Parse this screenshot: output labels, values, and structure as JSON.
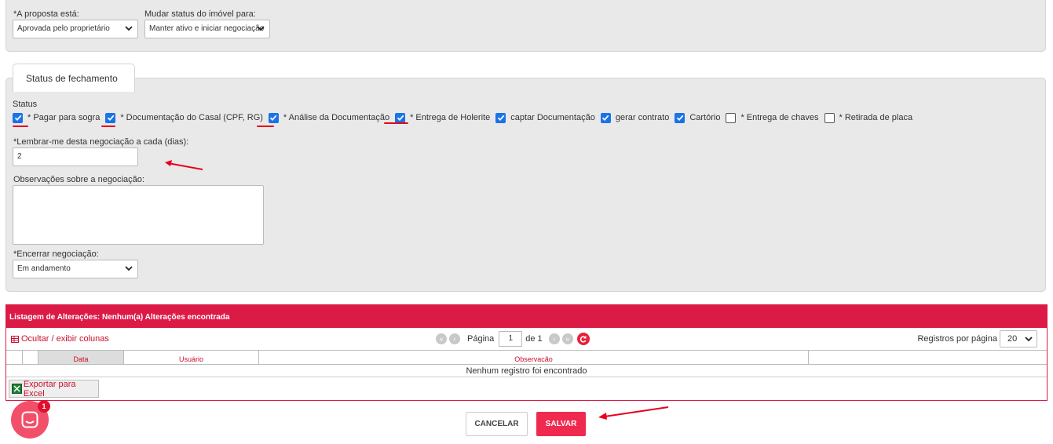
{
  "proposal": {
    "status_label": "*A proposta está:",
    "status_value": "Aprovada pelo proprietário",
    "property_status_label": "Mudar status do imóvel para:",
    "property_status_value": "Manter ativo e iniciar negociação"
  },
  "closing": {
    "tab_title": "Status de fechamento",
    "status_label": "Status",
    "checkboxes": [
      {
        "label": "* Pagar para sogra",
        "checked": true
      },
      {
        "label": "* Documentação do Casal (CPF, RG)",
        "checked": true
      },
      {
        "label": "* Análise da Documentação",
        "checked": true
      },
      {
        "label": "* Entrega de Holerite",
        "checked": true
      },
      {
        "label": "captar Documentação",
        "checked": true
      },
      {
        "label": "gerar contrato",
        "checked": true
      },
      {
        "label": "Cartório",
        "checked": true
      },
      {
        "label": "* Entrega de chaves",
        "checked": false
      },
      {
        "label": "* Retirada de placa",
        "checked": false
      }
    ],
    "remind_label": "*Lembrar-me desta negociação a cada (dias):",
    "remind_value": "2",
    "notes_label": "Observações sobre a negociação:",
    "notes_value": "",
    "end_label": "*Encerrar negociação:",
    "end_value": "Em andamento"
  },
  "listing": {
    "title": "Listagem de Alterações: Nenhum(a) Alterações encontrada",
    "toggle_columns": "Ocultar / exibir colunas",
    "page_label": "Página",
    "page_value": "1",
    "page_of": "de 1",
    "per_page_label": "Registros por página",
    "per_page_value": "20",
    "columns": [
      "Data",
      "Usuário",
      "Observacão"
    ],
    "empty_message": "Nenhum registro foi encontrado",
    "export_label": "Exportar para Excel"
  },
  "actions": {
    "cancel": "CANCELAR",
    "save": "SALVAR"
  },
  "chat": {
    "badge": "1"
  },
  "colors": {
    "accent": "#dc1a46",
    "save": "#f0294f",
    "checkbox": "#1a73e8",
    "annotation": "#e8001c"
  }
}
